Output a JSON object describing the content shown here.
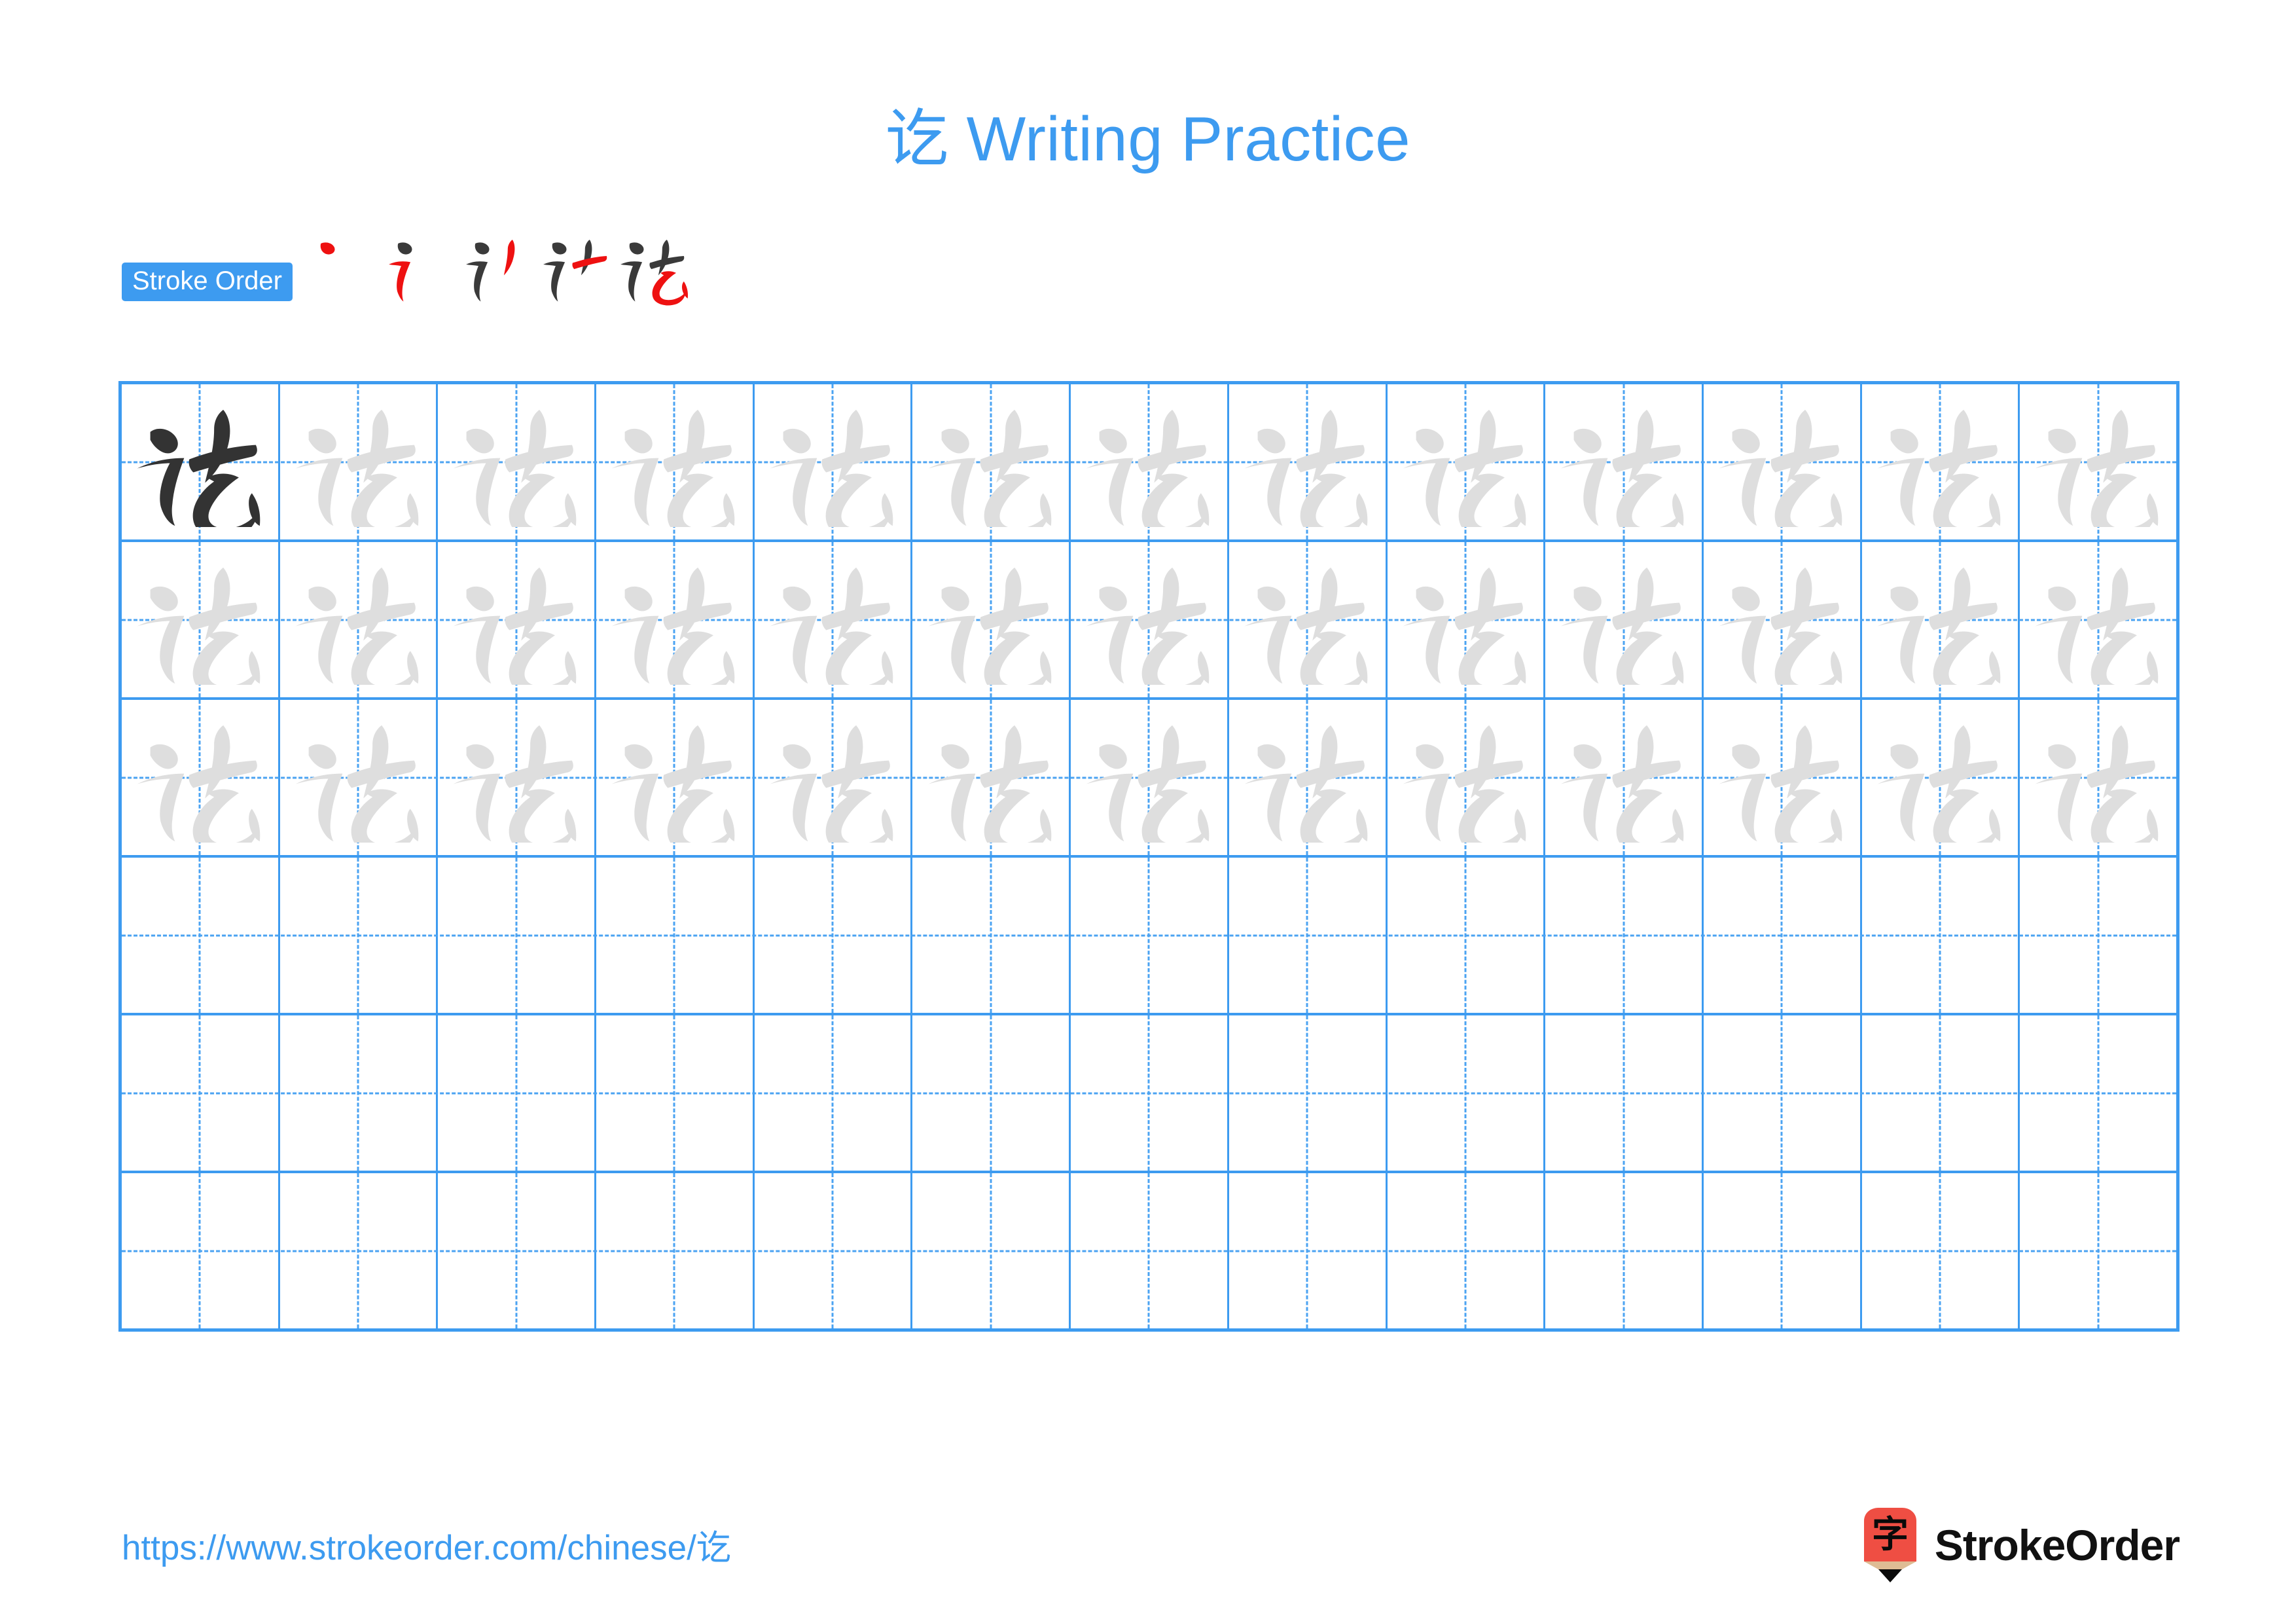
{
  "character": "讫",
  "title": {
    "full": "讫 Writing Practice",
    "character": "讫",
    "suffix": " Writing Practice"
  },
  "colors": {
    "accent_blue": "#3d9bf0",
    "grid_line": "#3d9bf0",
    "guide_line": "#4ba3f2",
    "dark_char": "#333333",
    "trace_char": "#dedede",
    "stroke_new": "#ee1111",
    "stroke_old": "#3a3a3a",
    "logo_red": "#ef4e43",
    "logo_tan": "#debc94"
  },
  "stroke_order": {
    "badge_label": "Stroke Order",
    "stroke_count": 5,
    "steps": [
      {
        "index": 1,
        "name": "stroke-step-1",
        "strokes_shown": 1
      },
      {
        "index": 2,
        "name": "stroke-step-2",
        "strokes_shown": 2
      },
      {
        "index": 3,
        "name": "stroke-step-3",
        "strokes_shown": 3
      },
      {
        "index": 4,
        "name": "stroke-step-4",
        "strokes_shown": 4
      },
      {
        "index": 5,
        "name": "stroke-step-5",
        "strokes_shown": 5
      }
    ]
  },
  "grid": {
    "columns": 13,
    "rows": 6,
    "row_types": [
      "model-then-trace",
      "trace",
      "trace",
      "blank",
      "blank",
      "blank"
    ],
    "filled_cells_row1": 13,
    "filled_cells_row2": 13,
    "filled_cells_row3": 13
  },
  "footer": {
    "url_prefix": "https://www.strokeorder.com/chinese/",
    "url_character": "讫",
    "url_full": "https://www.strokeorder.com/chinese/讫",
    "brand_name": "StrokeOrder",
    "logo_character": "字"
  }
}
